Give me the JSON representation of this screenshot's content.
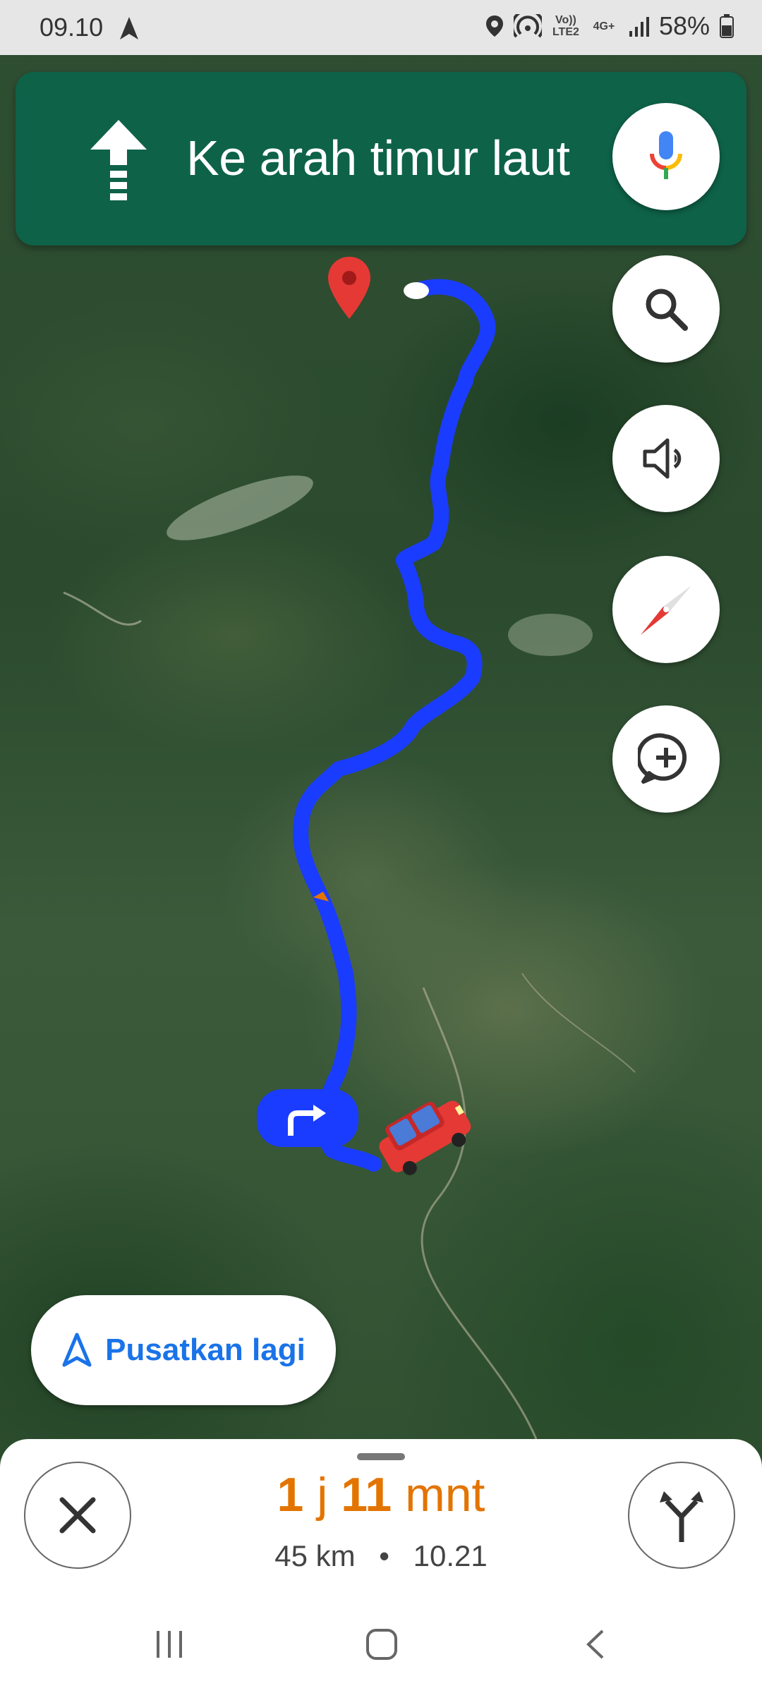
{
  "status_bar": {
    "time": "09.10",
    "volte": "Vo)) LTE2",
    "network": "4G+",
    "battery": "58%"
  },
  "banner": {
    "direction_text": "Ke arah timur laut",
    "direction_icon": "straight-arrow-icon",
    "color": "#0e6248"
  },
  "map_controls": [
    "mic-icon",
    "search-icon",
    "sound-icon",
    "compass-icon",
    "add-report-icon"
  ],
  "map": {
    "turn_marker_icon": "turn-right-icon",
    "vehicle_icon": "red-car-icon",
    "destination_icon": "red-pin-icon",
    "route_color": "#1a3cff"
  },
  "recenter": {
    "label": "Pusatkan lagi",
    "color": "#1a73e8"
  },
  "eta": {
    "hours": "1",
    "hours_unit": "j",
    "minutes": "11",
    "minutes_unit": "mnt",
    "distance": "45 km",
    "separator": "•",
    "arrival_time": "10.21",
    "color": "#e37400"
  },
  "android_nav": [
    "recents-icon",
    "home-icon",
    "back-icon"
  ]
}
